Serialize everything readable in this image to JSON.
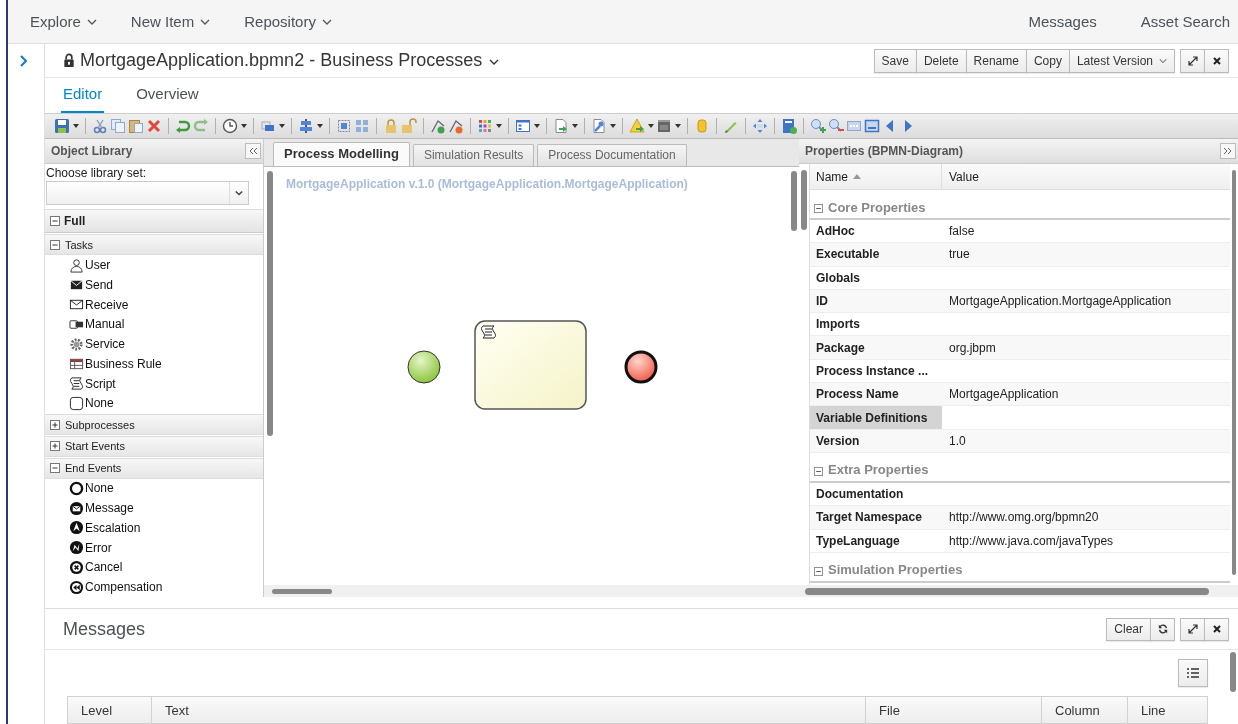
{
  "top_nav": {
    "menus": [
      {
        "label": "Explore"
      },
      {
        "label": "New Item"
      },
      {
        "label": "Repository"
      }
    ],
    "links": [
      "Messages",
      "Asset Search"
    ]
  },
  "editor": {
    "title": "MortgageApplication.bpmn2 - Business Processes",
    "actions": [
      "Save",
      "Delete",
      "Rename",
      "Copy"
    ],
    "version_menu": "Latest Version",
    "tabs": [
      {
        "label": "Editor",
        "selected": true
      },
      {
        "label": "Overview",
        "selected": false
      }
    ]
  },
  "object_library": {
    "title": "Object Library",
    "choose_label": "Choose library set:",
    "set": {
      "label": "Full",
      "expanded": true
    },
    "groups": [
      {
        "label": "Tasks",
        "expanded": true,
        "items": [
          "User",
          "Send",
          "Receive",
          "Manual",
          "Service",
          "Business Rule",
          "Script",
          "None"
        ]
      },
      {
        "label": "Subprocesses",
        "expanded": false
      },
      {
        "label": "Start Events",
        "expanded": false
      },
      {
        "label": "End Events",
        "expanded": true,
        "items": [
          "None",
          "Message",
          "Escalation",
          "Error",
          "Cancel",
          "Compensation"
        ]
      }
    ]
  },
  "canvas": {
    "tabs": [
      {
        "label": "Process Modelling",
        "selected": true
      },
      {
        "label": "Simulation Results",
        "selected": false
      },
      {
        "label": "Process Documentation",
        "selected": false
      }
    ],
    "heading": "MortgageApplication v.1.0 (MortgageApplication.MortgageApplication)"
  },
  "properties": {
    "title": "Properties (BPMN-Diagram)",
    "columns": [
      "Name",
      "Value"
    ],
    "sections": [
      {
        "title": "Core Properties",
        "expanded": true,
        "rows": [
          {
            "name": "AdHoc",
            "value": "false",
            "selected": false
          },
          {
            "name": "Executable",
            "value": "true",
            "selected": false
          },
          {
            "name": "Globals",
            "selected": false
          },
          {
            "name": "ID",
            "value": "MortgageApplication.MortgageApplication",
            "selected": false
          },
          {
            "name": "Imports",
            "selected": false
          },
          {
            "name": "Package",
            "value": "org.jbpm",
            "selected": false
          },
          {
            "name": "Process Instance ...",
            "selected": false
          },
          {
            "name": "Process Name",
            "value": "MortgageApplication",
            "selected": false
          },
          {
            "name": "Variable Definitions",
            "selected": true
          },
          {
            "name": "Version",
            "value": "1.0",
            "selected": false
          }
        ]
      },
      {
        "title": "Extra Properties",
        "expanded": true,
        "rows": [
          {
            "name": "Documentation",
            "selected": false
          },
          {
            "name": "Target Namespace",
            "value": "http://www.omg.org/bpmn20",
            "selected": false
          },
          {
            "name": "TypeLanguage",
            "value": "http://www.java.com/javaTypes",
            "selected": false
          }
        ]
      },
      {
        "title": "Simulation Properties",
        "expanded": true
      }
    ]
  },
  "messages": {
    "title": "Messages",
    "clear": "Clear",
    "columns": [
      "Level",
      "Text",
      "File",
      "Column",
      "Line"
    ]
  }
}
